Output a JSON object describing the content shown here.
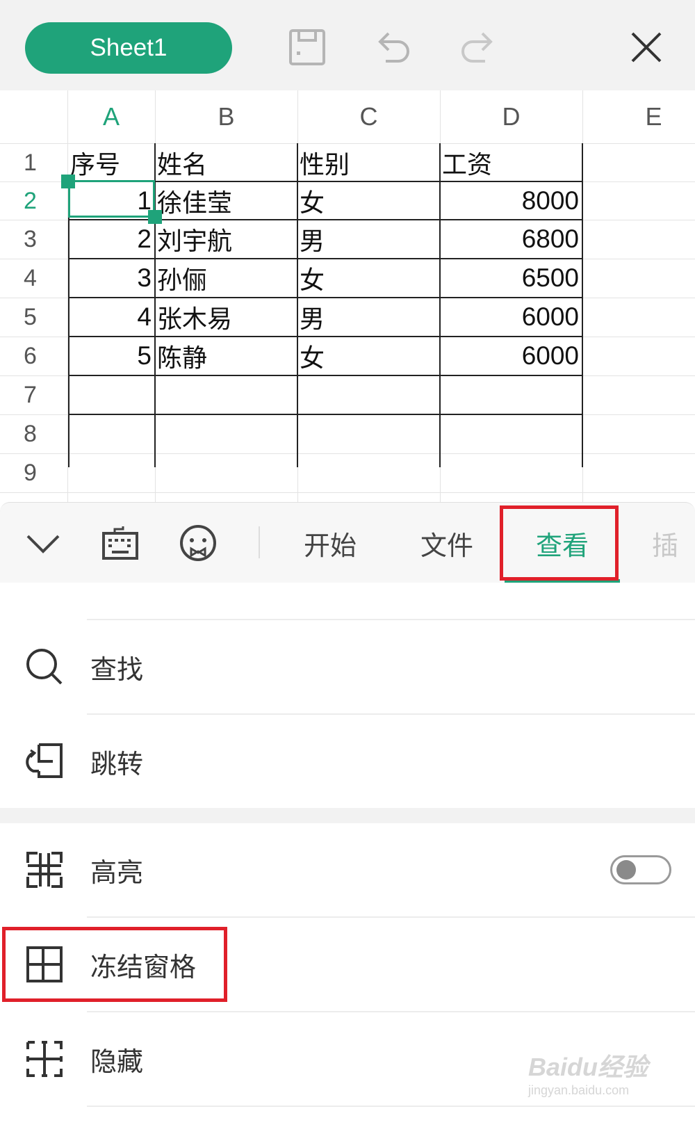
{
  "header": {
    "sheet_tab": "Sheet1",
    "icons": [
      "save-icon",
      "undo-icon",
      "redo-icon",
      "close-icon"
    ]
  },
  "sheet": {
    "columns": [
      "A",
      "B",
      "C",
      "D",
      "E"
    ],
    "active_column": "A",
    "rows": [
      "1",
      "2",
      "3",
      "4",
      "5",
      "6",
      "7",
      "8",
      "9"
    ],
    "active_row": "2",
    "headers": [
      "序号",
      "姓名",
      "性别",
      "工资"
    ],
    "data": [
      [
        "1",
        "徐佳莹",
        "女",
        "8000"
      ],
      [
        "2",
        "刘宇航",
        "男",
        "6800"
      ],
      [
        "3",
        "孙俪",
        "女",
        "6500"
      ],
      [
        "4",
        "张木易",
        "男",
        "6000"
      ],
      [
        "5",
        "陈静",
        "女",
        "6000"
      ]
    ]
  },
  "toolbar": {
    "icons": [
      "collapse-chevron-icon",
      "keyboard-icon",
      "emoji-icon"
    ],
    "tabs": [
      "开始",
      "文件",
      "查看",
      "插"
    ],
    "active_tab": "查看"
  },
  "menu": {
    "items": [
      {
        "label": "查找",
        "icon": "search-icon"
      },
      {
        "label": "跳转",
        "icon": "goto-icon"
      },
      {
        "label": "高亮",
        "icon": "highlight-icon",
        "toggle": false
      },
      {
        "label": "冻结窗格",
        "icon": "freeze-panes-icon"
      },
      {
        "label": "隐藏",
        "icon": "hide-icon"
      }
    ]
  },
  "watermark": {
    "logo": "Baidu经验",
    "url": "jingyan.baidu.com"
  },
  "colors": {
    "accent": "#1fa37a",
    "highlight_border": "#e0202a"
  }
}
